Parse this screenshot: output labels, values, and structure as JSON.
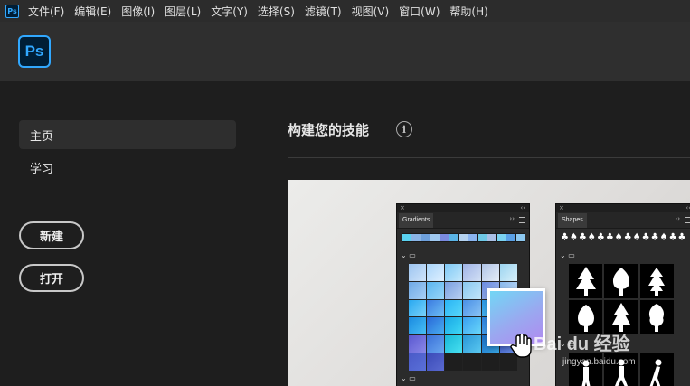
{
  "app": {
    "mini_logo": "Ps",
    "logo": "Ps"
  },
  "menu": [
    "文件(F)",
    "编辑(E)",
    "图像(I)",
    "图层(L)",
    "文字(Y)",
    "选择(S)",
    "滤镜(T)",
    "视图(V)",
    "窗口(W)",
    "帮助(H)"
  ],
  "sidebar": {
    "items": [
      {
        "label": "主页",
        "active": true
      },
      {
        "label": "学习",
        "active": false
      }
    ],
    "new_label": "新建",
    "open_label": "打开"
  },
  "main": {
    "section_title": "构建您的技能",
    "info_icon": "info-icon"
  },
  "gradients_panel": {
    "tab": "Gradients",
    "close": "×",
    "collapse": "‹‹ ›› "
  },
  "shapes_panel": {
    "tab": "Shapes",
    "close": "×"
  },
  "watermark": {
    "text": "Bai du 经验",
    "sub": "jingyan.baidu.com"
  },
  "colors": {
    "accent": "#31a8ff",
    "logo_bg": "#001e36",
    "menubar": "#2c2c2c",
    "header": "#2f2f2f",
    "body": "#1e1e1e"
  }
}
